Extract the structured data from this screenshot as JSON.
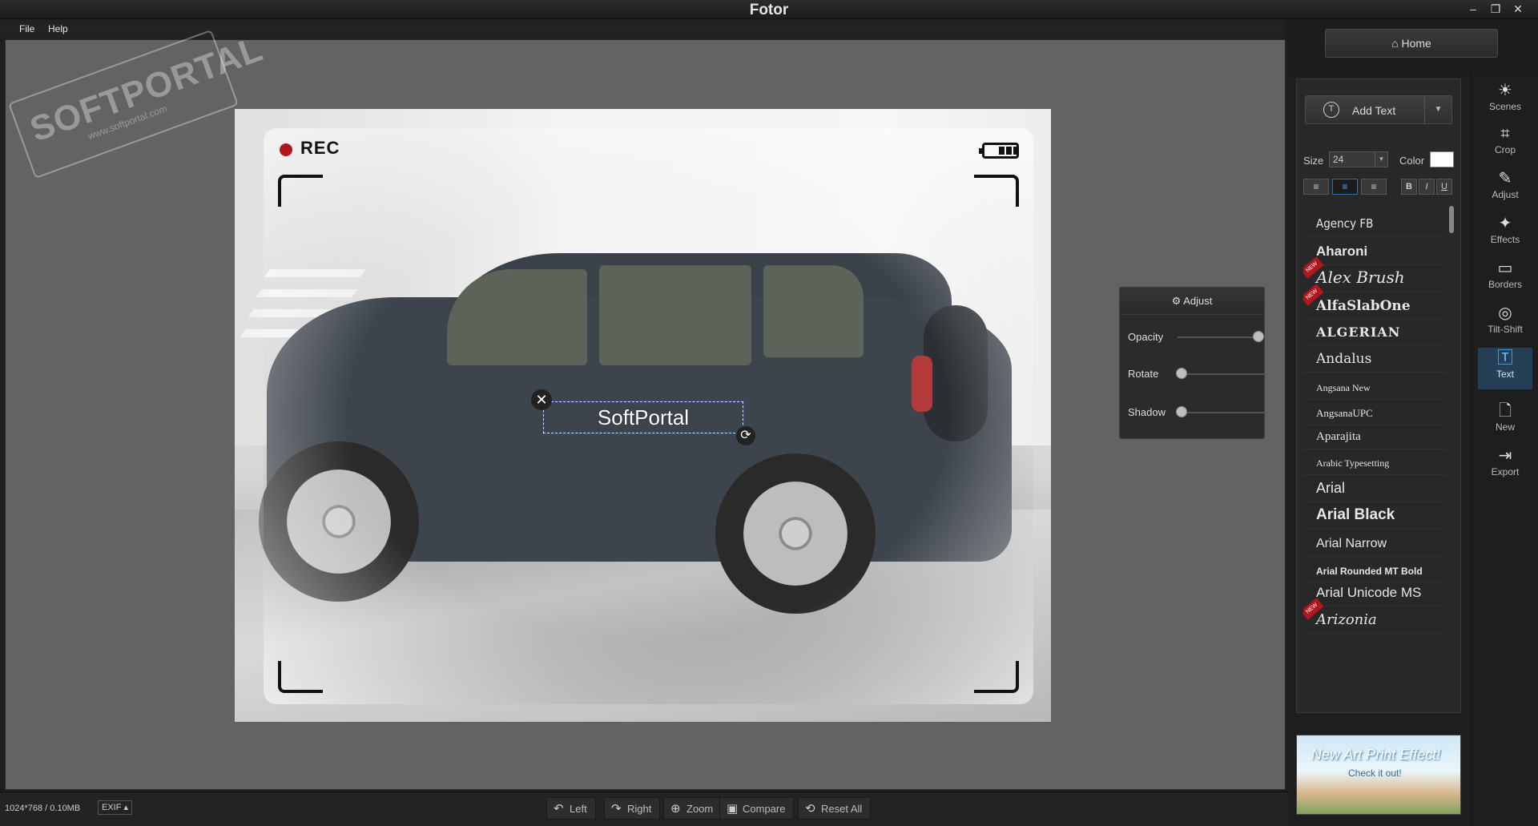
{
  "app": {
    "title": "Fotor"
  },
  "menu": [
    "File",
    "Help"
  ],
  "watermark": {
    "text": "SOFTPORTAL",
    "sub": "www.softportal.com"
  },
  "viewfinder": {
    "rec_label": "REC"
  },
  "text_layer": {
    "value": "SoftPortal",
    "close_glyph": "✕",
    "rotate_glyph": "⟳"
  },
  "adjust_panel": {
    "title": "Adjust",
    "rows": [
      {
        "label": "Opacity",
        "value": 1.0
      },
      {
        "label": "Rotate",
        "value": 0.0
      },
      {
        "label": "Shadow",
        "value": 0.0
      }
    ]
  },
  "status": {
    "image_info": "1024*768 / 0.10MB",
    "exif_label": "EXIF ▴"
  },
  "bottom_buttons": [
    {
      "label": "Left",
      "icon": "rotate-left-icon",
      "glyph": "↶"
    },
    {
      "label": "Right",
      "icon": "rotate-right-icon",
      "glyph": "↷"
    },
    {
      "label": "Zoom",
      "icon": "zoom-icon",
      "glyph": "⊕"
    },
    {
      "label": "Compare",
      "icon": "compare-icon",
      "glyph": "▣"
    },
    {
      "label": "Reset All",
      "icon": "reset-icon",
      "glyph": "⟲"
    }
  ],
  "home": {
    "label": "Home",
    "glyph": "⌂"
  },
  "text_panel": {
    "add_text_label": "Add Text",
    "add_text_icon": "T",
    "size_label": "Size",
    "size_value": "24",
    "color_label": "Color",
    "text_color": "#ffffff",
    "align": [
      "≡",
      "≡",
      "≡"
    ],
    "styles": [
      "B",
      "I",
      "U"
    ],
    "fonts": [
      {
        "name": "Agency FB",
        "new": false
      },
      {
        "name": "Aharoni",
        "new": false
      },
      {
        "name": "Alex Brush",
        "new": true
      },
      {
        "name": "AlfaSlabOne",
        "new": true
      },
      {
        "name": "ALGERIAN",
        "new": false
      },
      {
        "name": "Andalus",
        "new": false
      },
      {
        "name": "Angsana New",
        "new": false
      },
      {
        "name": "AngsanaUPC",
        "new": false
      },
      {
        "name": "Aparajita",
        "new": false
      },
      {
        "name": "Arabic Typesetting",
        "new": false
      },
      {
        "name": "Arial",
        "new": false
      },
      {
        "name": "Arial Black",
        "new": false
      },
      {
        "name": "Arial Narrow",
        "new": false
      },
      {
        "name": "Arial Rounded MT Bold",
        "new": false
      },
      {
        "name": "Arial Unicode MS",
        "new": false
      },
      {
        "name": "Arizonia",
        "new": true
      }
    ],
    "new_badge": "NEW"
  },
  "ad": {
    "title": "New Art Print Effect!",
    "sub": "Check it out!"
  },
  "tools": [
    {
      "label": "Scenes",
      "glyph": "☀",
      "icon": "scenes-icon",
      "active": false
    },
    {
      "label": "Crop",
      "glyph": "⌗",
      "icon": "crop-icon",
      "active": false
    },
    {
      "label": "Adjust",
      "glyph": "✎",
      "icon": "adjust-icon",
      "active": false
    },
    {
      "label": "Effects",
      "glyph": "✦",
      "icon": "effects-icon",
      "active": false
    },
    {
      "label": "Borders",
      "glyph": "▭",
      "icon": "borders-icon",
      "active": false
    },
    {
      "label": "Tilt-Shift",
      "glyph": "◎",
      "icon": "tilt-shift-icon",
      "active": false
    },
    {
      "label": "Text",
      "glyph": "🅃",
      "icon": "text-icon",
      "active": true
    },
    {
      "label": "New",
      "glyph": "🗋",
      "icon": "new-icon",
      "active": false
    },
    {
      "label": "Export",
      "glyph": "⇥",
      "icon": "export-icon",
      "active": false
    }
  ],
  "window_controls": [
    "–",
    "❐",
    "✕"
  ]
}
